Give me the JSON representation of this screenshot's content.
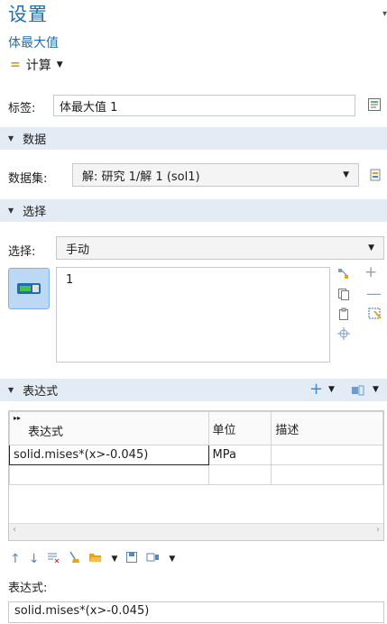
{
  "header": {
    "title": "设置",
    "subtitle": "体最大值",
    "calc_label": "计算"
  },
  "label_row": {
    "label": "标签:",
    "value": "体最大值 1"
  },
  "sections": {
    "data": "数据",
    "selection": "选择",
    "expression": "表达式"
  },
  "dataset": {
    "label": "数据集:",
    "value": "解: 研究 1/解 1 (sol1)"
  },
  "selection": {
    "label": "选择:",
    "value": "手动",
    "items": [
      "1"
    ]
  },
  "table": {
    "headers": [
      "表达式",
      "单位",
      "描述"
    ],
    "rows": [
      [
        "solid.mises*(x>-0.045)",
        "MPa",
        ""
      ],
      [
        "",
        "",
        ""
      ]
    ]
  },
  "expression_field": {
    "label": "表达式:",
    "value": "solid.mises*(x>-0.045)"
  },
  "icons": {
    "edit": "edit-note-icon",
    "dataset_go": "go-to-source-icon",
    "toggle": "selection-toggle-icon",
    "add": "plus-icon",
    "remove": "minus-icon",
    "copy": "copy-icon",
    "paste": "paste-icon",
    "zoom": "zoom-selection-icon",
    "clear": "clear-selection-icon",
    "up": "move-up-icon",
    "down": "move-down-icon",
    "delete": "delete-rows-icon",
    "broom": "clear-table-icon",
    "open": "open-folder-icon",
    "save": "save-icon",
    "settings": "table-settings-icon"
  },
  "colors": {
    "accent": "#1f6fb0",
    "section_bg": "#e3ebf4"
  }
}
